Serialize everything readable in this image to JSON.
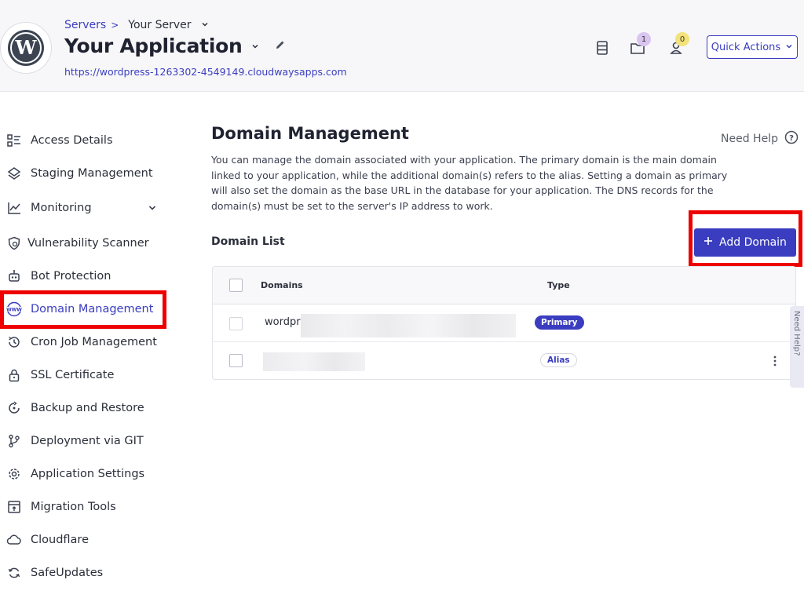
{
  "header": {
    "breadcrumb": {
      "servers": "Servers",
      "separator": ">",
      "server": "Your Server"
    },
    "app_title": "Your Application",
    "app_url": "https://wordpress-1263302-4549149.cloudwaysapps.com",
    "badges": {
      "folder": "1",
      "users": "0"
    },
    "quick_actions": "Quick Actions"
  },
  "sidebar": {
    "items": [
      {
        "label": "Access Details",
        "icon": "access-details-icon"
      },
      {
        "label": "Staging Management",
        "icon": "layers-icon"
      },
      {
        "label": "Monitoring",
        "icon": "chart-line-icon"
      },
      {
        "label": "Vulnerability Scanner",
        "icon": "shield-scan-icon"
      },
      {
        "label": "Bot Protection",
        "icon": "robot-icon"
      },
      {
        "label": "Domain Management",
        "icon": "www-globe-icon",
        "active": true
      },
      {
        "label": "Cron Job Management",
        "icon": "clock-history-icon"
      },
      {
        "label": "SSL Certificate",
        "icon": "lock-icon"
      },
      {
        "label": "Backup and Restore",
        "icon": "backup-icon"
      },
      {
        "label": "Deployment via GIT",
        "icon": "git-branch-icon"
      },
      {
        "label": "Application Settings",
        "icon": "gear-icon"
      },
      {
        "label": "Migration Tools",
        "icon": "migration-icon"
      },
      {
        "label": "Cloudflare",
        "icon": "cloud-icon"
      },
      {
        "label": "SafeUpdates",
        "icon": "refresh-icon"
      }
    ]
  },
  "main": {
    "title": "Domain Management",
    "need_help": "Need Help",
    "description": "You can manage the domain associated with your application. The primary domain is the main domain linked to your application, while the additional domain(s) refers to the alias. Setting a domain as primary will also set the domain as the base URL in the database for your application. The DNS records for the domain(s) must be set to the server's IP address to work.",
    "domain_list_title": "Domain List",
    "add_domain": "Add Domain",
    "table": {
      "columns": [
        "Domains",
        "Type"
      ],
      "rows": [
        {
          "domain": "wordpre",
          "type": "Primary"
        },
        {
          "domain": "",
          "type": "Alias"
        }
      ]
    }
  },
  "feedback_tab": "Need Help?"
}
